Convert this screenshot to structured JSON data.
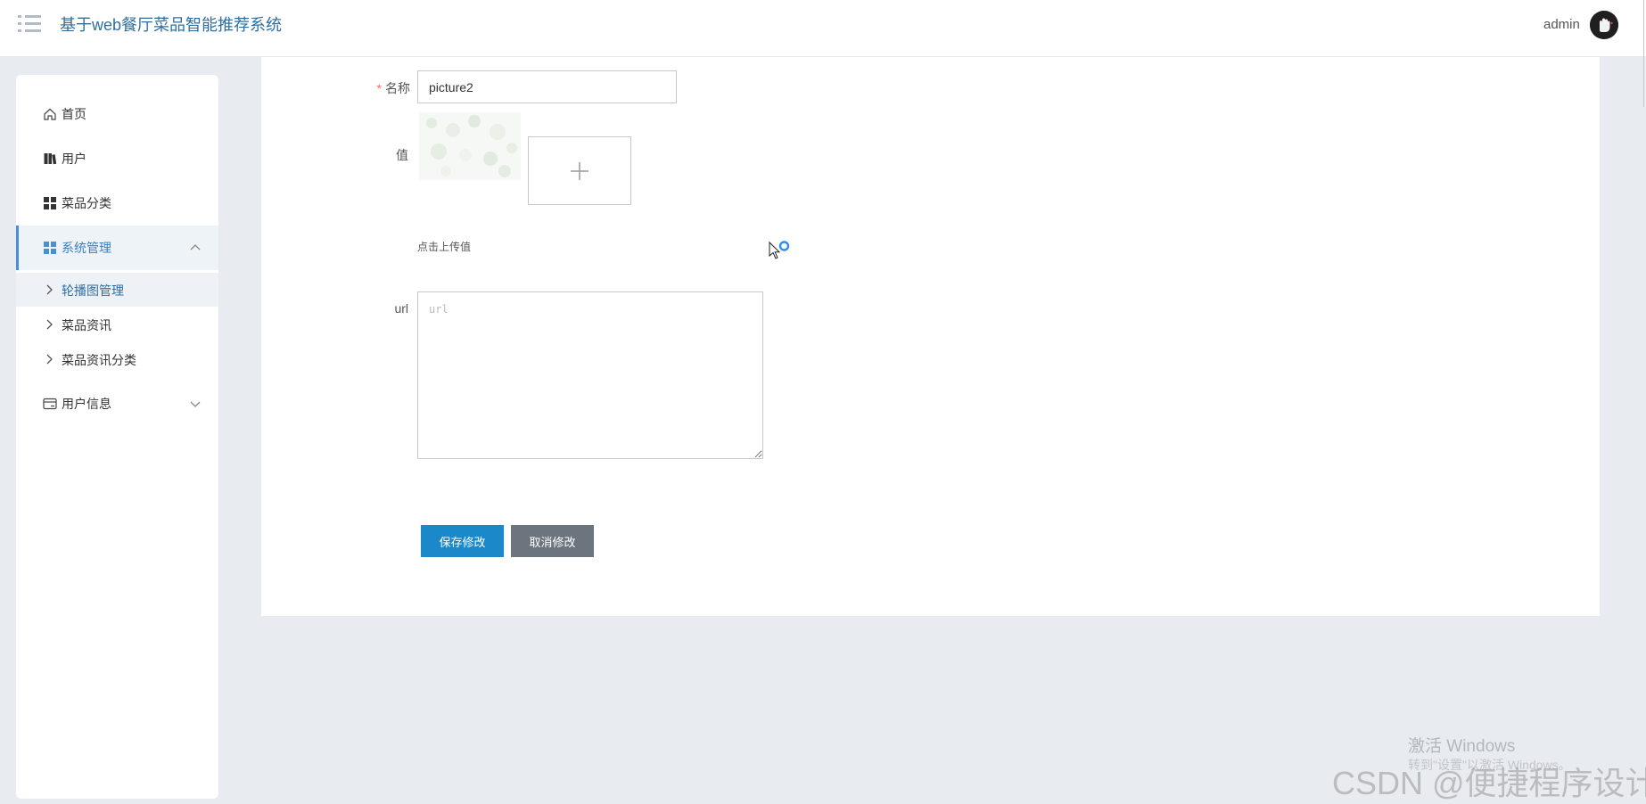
{
  "header": {
    "title": "基于web餐厅菜品智能推荐系统",
    "user": "admin"
  },
  "sidebar": {
    "items": [
      {
        "label": "首页",
        "icon": "home-icon"
      },
      {
        "label": "用户",
        "icon": "book-icon"
      },
      {
        "label": "菜品分类",
        "icon": "grid-icon"
      },
      {
        "label": "系统管理",
        "icon": "grid-icon",
        "expanded": true,
        "active": true,
        "children": [
          {
            "label": "轮播图管理",
            "active": true
          },
          {
            "label": "菜品资讯"
          },
          {
            "label": "菜品资讯分类"
          }
        ]
      },
      {
        "label": "用户信息",
        "icon": "card-icon",
        "expanded": false
      }
    ]
  },
  "form": {
    "name_label": "名称",
    "name_required_mark": "*",
    "name_value": "picture2",
    "value_label": "值",
    "upload_hint": "点击上传值",
    "url_label": "url",
    "url_placeholder": "url",
    "save_button": "保存修改",
    "cancel_button": "取消修改"
  },
  "overlays": {
    "windows_watermark": "激活 Windows",
    "windows_watermark_sub": "转到\"设置\"以激活 Windows。",
    "csdn_watermark": "CSDN @便捷程序设计"
  },
  "colors": {
    "accent": "#2f6f9f",
    "save_button": "#1a88c9",
    "cancel_button": "#6c757d",
    "page_background": "#e8ebf0",
    "required": "#f56c6c"
  }
}
